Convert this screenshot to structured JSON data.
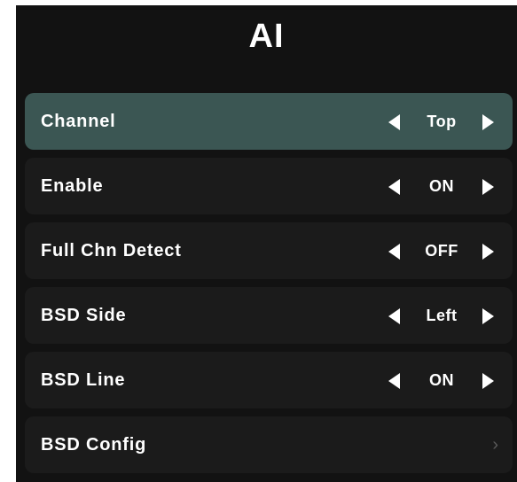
{
  "title": "AI",
  "menu": {
    "items": [
      {
        "label": "Channel",
        "value": "Top",
        "type": "selector",
        "selected": true
      },
      {
        "label": "Enable",
        "value": "ON",
        "type": "selector",
        "selected": false
      },
      {
        "label": "Full Chn Detect",
        "value": "OFF",
        "type": "selector",
        "selected": false
      },
      {
        "label": "BSD Side",
        "value": "Left",
        "type": "selector",
        "selected": false
      },
      {
        "label": "BSD Line",
        "value": "ON",
        "type": "selector",
        "selected": false
      },
      {
        "label": "BSD Config",
        "chevron": "›",
        "type": "submenu",
        "selected": false
      }
    ]
  },
  "colors": {
    "background": "#121212",
    "row": "#1b1b1b",
    "selected_row": "#3b5653",
    "text": "#ffffff",
    "chevron": "#5a5a5a"
  },
  "icons": {
    "left": "left-arrow-icon",
    "right": "right-arrow-icon",
    "submenu": "chevron-right-icon"
  }
}
